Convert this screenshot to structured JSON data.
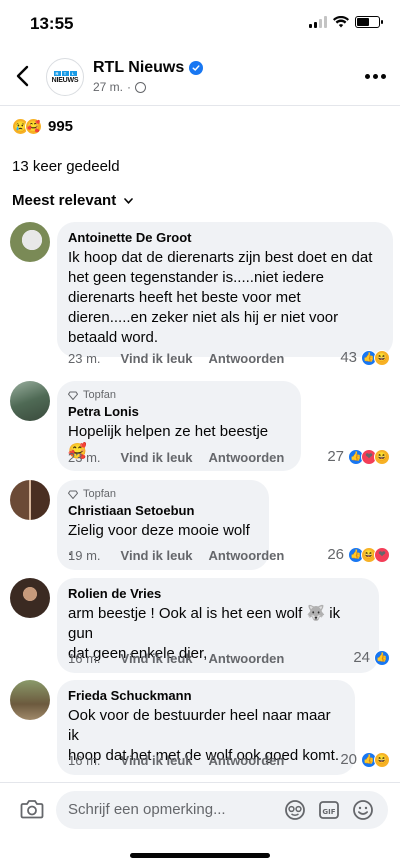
{
  "status": {
    "time": "13:55"
  },
  "header": {
    "page_name": "RTL Nieuws",
    "post_time": "27 m.",
    "logo_text": "NIEUWS"
  },
  "reactions": {
    "total": "995",
    "types": [
      "sad",
      "care"
    ]
  },
  "shares": "13 keer gedeeld",
  "sort": {
    "label": "Meest relevant"
  },
  "actions": {
    "like": "Vind ik leuk",
    "reply": "Antwoorden"
  },
  "comments": [
    {
      "author": "Antoinette De Groot",
      "topfan": false,
      "lines": [
        "Ik hoop dat de dierenarts zijn best doet en dat",
        "het geen tegenstander is.....niet iedere",
        "dierenarts heeft het beste voor met",
        "dieren.....en zeker niet als hij er niet voor",
        "betaald word."
      ],
      "time": "23 m.",
      "reaction_count": "43",
      "reaction_types": [
        "like",
        "haha"
      ]
    },
    {
      "author": "Petra Lonis",
      "topfan": true,
      "topfan_label": "Topfan",
      "lines": [
        "Hopelijk helpen ze het beestje 🥰"
      ],
      "time": "23 m.",
      "reaction_count": "27",
      "reaction_types": [
        "like",
        "heart",
        "haha"
      ]
    },
    {
      "author": "Christiaan Setoebun",
      "topfan": true,
      "topfan_label": "Topfan",
      "lines": [
        "Zielig voor deze mooie wolf ."
      ],
      "time": "19 m.",
      "reaction_count": "26",
      "reaction_types": [
        "like",
        "haha",
        "heart"
      ]
    },
    {
      "author": "Rolien de Vries",
      "topfan": false,
      "lines": [
        "arm beestje ! Ook al is het een wolf 🐺 ik gun",
        "dat geen enkele dier,"
      ],
      "time": "16 m.",
      "reaction_count": "24",
      "reaction_types": [
        "like"
      ]
    },
    {
      "author": "Frieda Schuckmann",
      "topfan": false,
      "lines": [
        "Ook voor de bestuurder heel naar maar ik",
        "hoop dat het met de wolf ook goed komt."
      ],
      "time": "16 m.",
      "reaction_count": "20",
      "reaction_types": [
        "like",
        "haha"
      ]
    }
  ],
  "composer": {
    "placeholder": "Schrijf een opmerking..."
  },
  "colors": {
    "accent": "#1877f2",
    "bubble": "#f0f2f5",
    "secondary_text": "#65676b"
  }
}
